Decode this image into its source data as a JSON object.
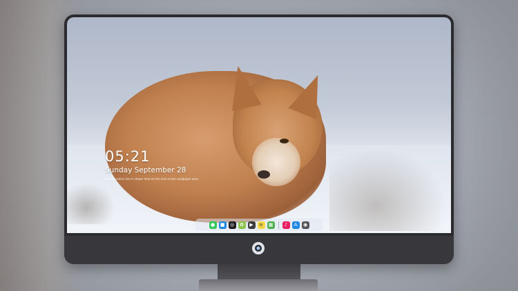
{
  "lock_screen": {
    "time": "05:21",
    "date": "Sunday September 28",
    "notice": "A small notice line is shown here on the lock screen wallpaper area"
  },
  "dock": {
    "apps": [
      {
        "name": "messages",
        "color": "#34c759",
        "glyph": "●"
      },
      {
        "name": "finder",
        "color": "#1e88e5",
        "glyph": "■"
      },
      {
        "name": "safari",
        "color": "#1c1c1e",
        "glyph": "◎"
      },
      {
        "name": "photos",
        "color": "#8ac34a",
        "glyph": "✿"
      },
      {
        "name": "clapper",
        "color": "#3c3c3c",
        "glyph": "▶"
      },
      {
        "name": "notes",
        "color": "#f5d742",
        "glyph": "≡"
      },
      {
        "name": "preview",
        "color": "#4caf50",
        "glyph": "▦"
      },
      {
        "name": "itunes",
        "color": "#e91e63",
        "glyph": "♪"
      },
      {
        "name": "app-store",
        "color": "#1e88e5",
        "glyph": "A"
      },
      {
        "name": "camera",
        "color": "#555558",
        "glyph": "◉"
      }
    ]
  },
  "colors": {
    "bezel": "#2b2b2f",
    "chin": "#38383c",
    "accent": "#1e88e5"
  }
}
